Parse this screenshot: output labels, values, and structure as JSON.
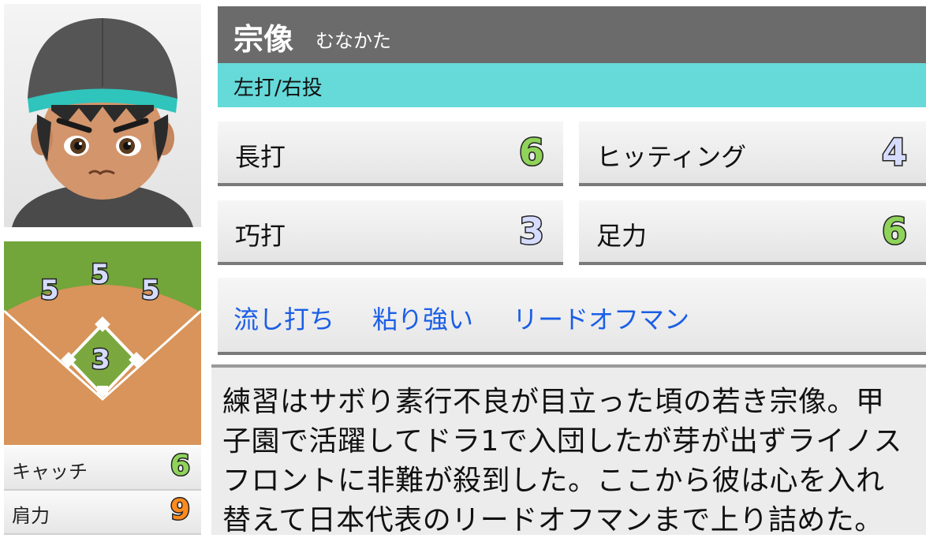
{
  "player": {
    "name": "宗像",
    "kana": "むなかた",
    "handedness": "左打/右投"
  },
  "batting_stats": [
    {
      "label": "長打",
      "value": "6",
      "color": "#8fd35a"
    },
    {
      "label": "ヒッティング",
      "value": "4",
      "color": "#d6dcff"
    },
    {
      "label": "巧打",
      "value": "3",
      "color": "#d6dcff"
    },
    {
      "label": "足力",
      "value": "6",
      "color": "#8fd35a"
    }
  ],
  "abilities": [
    "流し打ち",
    "粘り強い",
    "リードオフマン"
  ],
  "fielding": {
    "positions": {
      "left": "5",
      "center": "5",
      "right": "5",
      "infield": "3"
    }
  },
  "defense_stats": [
    {
      "label": "キャッチ",
      "value": "6",
      "color": "#8fd35a"
    },
    {
      "label": "肩力",
      "value": "9",
      "color": "#ff8a1e"
    }
  ],
  "description_lines": [
    "練習はサボり素行不良が目立った頃の若き宗像。甲",
    "子園で活躍してドラ1で入団したが芽が出ずライノス",
    "フロントに非難が殺到した。ここから彼は心を入れ",
    "替えて日本代表のリードオフマンまで上り詰めた。"
  ]
}
